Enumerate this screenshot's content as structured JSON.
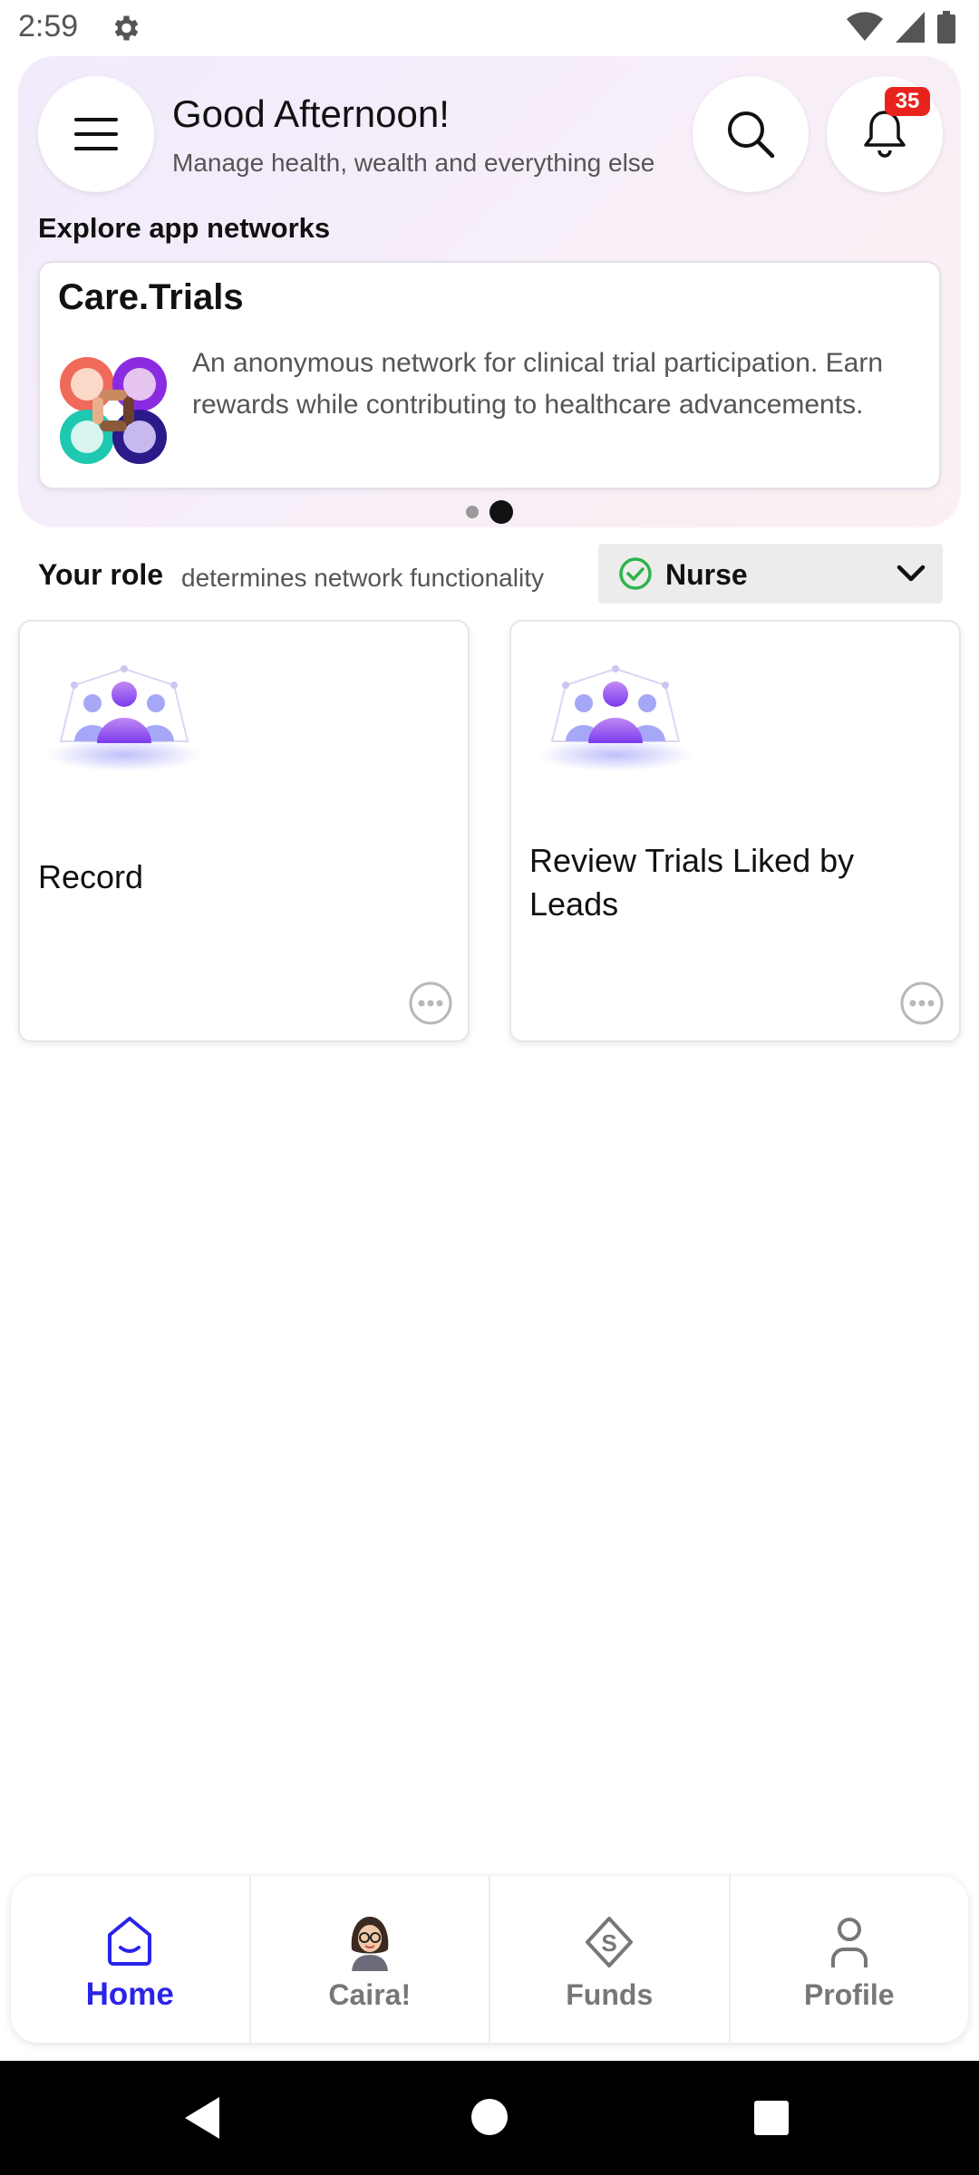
{
  "status_bar": {
    "time": "2:59",
    "icons": [
      "gear-icon",
      "wifi-icon",
      "signal-icon",
      "battery-icon"
    ]
  },
  "header": {
    "greeting": "Good Afternoon!",
    "subtitle": "Manage health, wealth and everything else",
    "notification_count": "35",
    "icons": {
      "menu": "hamburger-menu-icon",
      "search": "search-icon",
      "notifications": "bell-icon"
    }
  },
  "explore": {
    "title": "Explore app networks",
    "network": {
      "name": "Care.Trials",
      "description": "An anonymous network for clinical trial participation. Earn rewards while contributing to healthcare advancements."
    },
    "carousel": {
      "page_count": 2,
      "active_index": 1
    }
  },
  "role": {
    "label": "Your role",
    "description": "determines network functionality",
    "selected": "Nurse"
  },
  "cards": [
    {
      "title": "Record"
    },
    {
      "title": "Review Trials Liked by Leads"
    }
  ],
  "bottom_nav": [
    {
      "label": "Home",
      "icon": "home-icon",
      "active": true
    },
    {
      "label": "Caira!",
      "icon": "avatar-icon",
      "active": false
    },
    {
      "label": "Funds",
      "icon": "funds-icon",
      "active": false
    },
    {
      "label": "Profile",
      "icon": "profile-icon",
      "active": false
    }
  ],
  "colors": {
    "accent": "#2a24e8",
    "badge": "#e8231d",
    "check": "#2db34a",
    "illustration_purple": "#8b5cf6"
  }
}
